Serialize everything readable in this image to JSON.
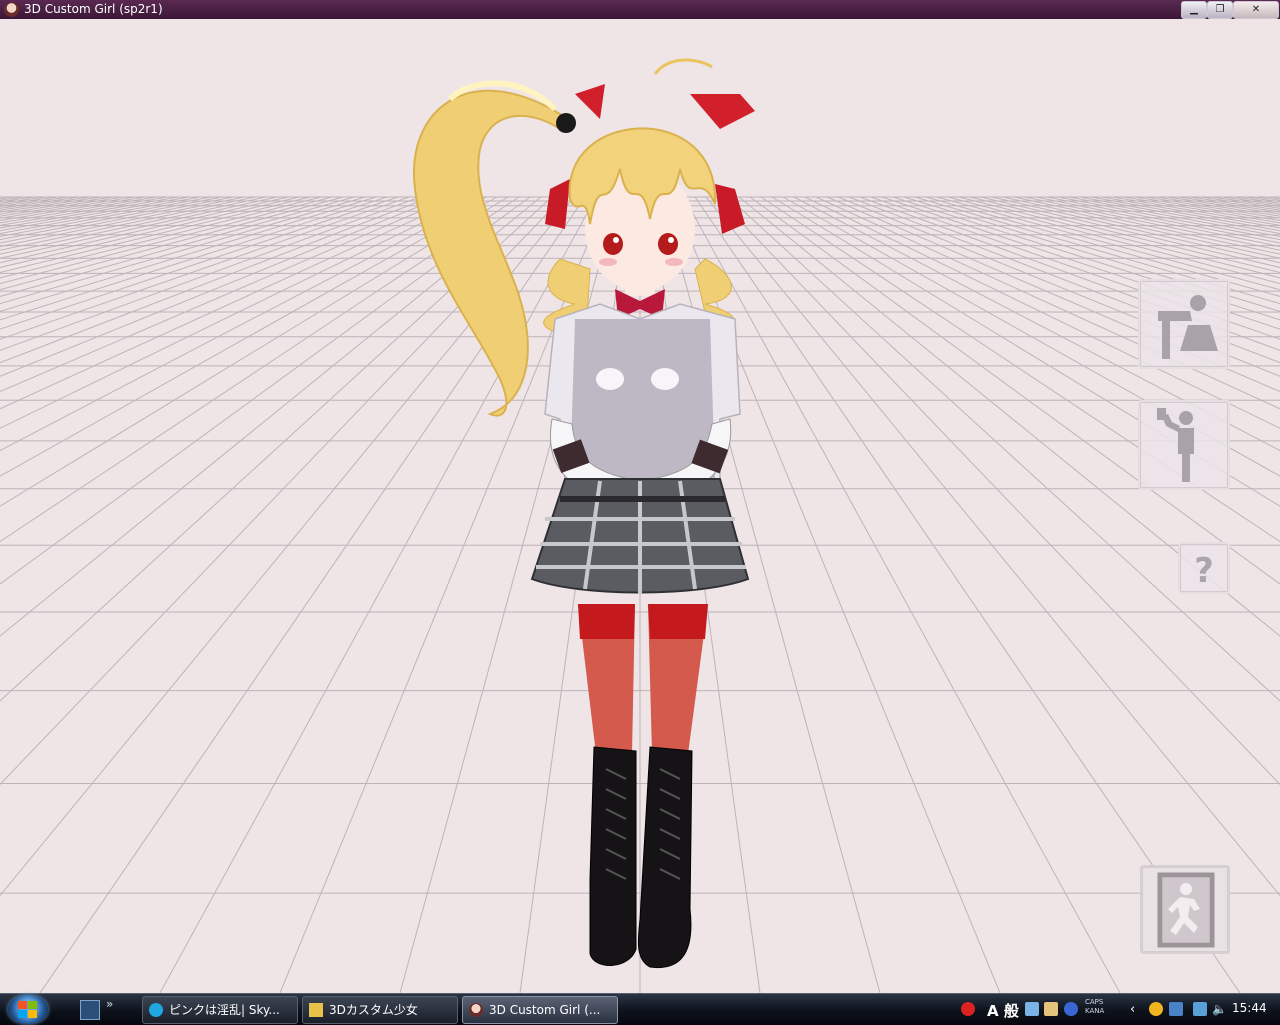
{
  "window": {
    "title": "3D Custom Girl (sp2r1)",
    "buttons": {
      "minimize": "▁",
      "maximize": "❐",
      "close": "✕"
    }
  },
  "viewport": {
    "background_color": "#efe5e7",
    "grid_color": "#b9b0b3",
    "side_buttons": [
      {
        "name": "bow-pose-icon"
      },
      {
        "name": "drink-pose-icon"
      },
      {
        "name": "help-icon",
        "label": "?"
      },
      {
        "name": "exit-icon"
      }
    ]
  },
  "taskbar": {
    "quicklaunch_chevron": "»",
    "tasks": [
      {
        "label": "ピンクは淫乱| Sky...",
        "icon": "skype-icon",
        "active": false
      },
      {
        "label": "3Dカスタム少女",
        "icon": "folder-icon",
        "active": false
      },
      {
        "label": "3D Custom Girl (...",
        "icon": "app-icon",
        "active": true
      }
    ],
    "tray": {
      "ime_mode": "A 般",
      "caps": "CAPS",
      "kana": "KANA",
      "clock": "15:44"
    }
  },
  "colors": {
    "titlebar": "#4a2043",
    "taskbar": "#0d121b",
    "hair": "#f2d27a",
    "ribbon": "#d61f2a"
  }
}
